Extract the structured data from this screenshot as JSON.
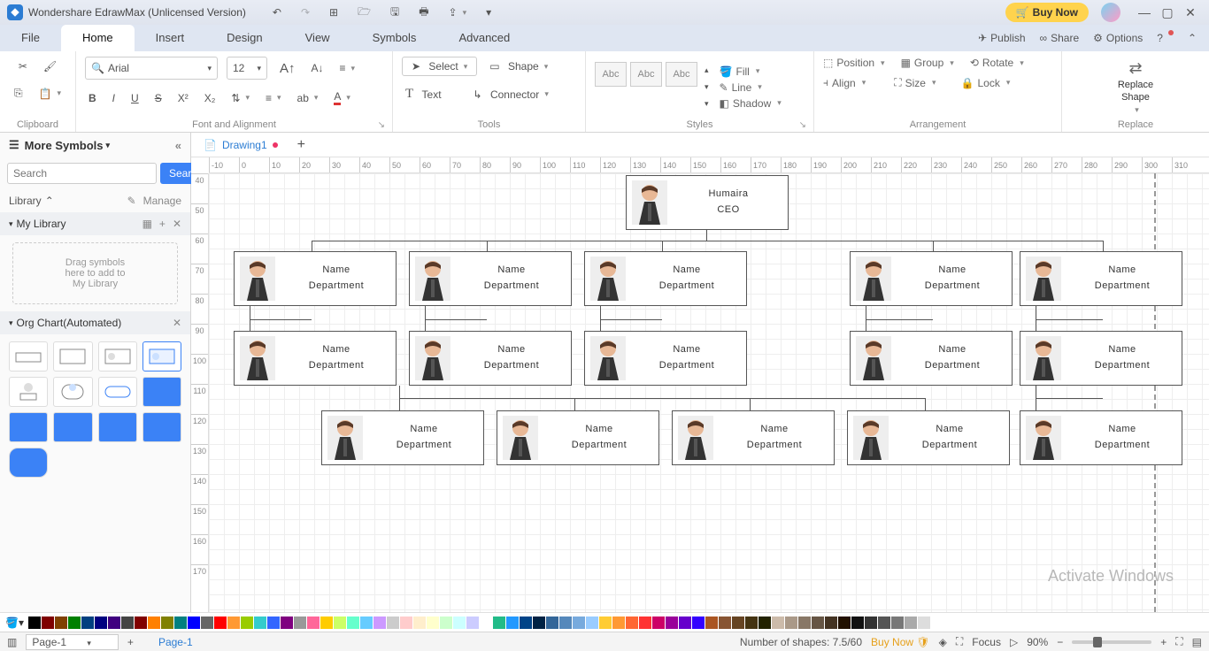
{
  "titlebar": {
    "title": "Wondershare EdrawMax (Unlicensed Version)",
    "buy": "Buy Now"
  },
  "menu": {
    "file": "File",
    "home": "Home",
    "insert": "Insert",
    "design": "Design",
    "view": "View",
    "symbols": "Symbols",
    "advanced": "Advanced",
    "publish": "Publish",
    "share": "Share",
    "options": "Options"
  },
  "ribbon": {
    "clipboard": "Clipboard",
    "font_alignment": "Font and Alignment",
    "tools": "Tools",
    "styles": "Styles",
    "arrangement": "Arrangement",
    "replace": "Replace",
    "font_name": "Arial",
    "font_size": "12",
    "select": "Select",
    "shape": "Shape",
    "text": "Text",
    "connector": "Connector",
    "style_abc": "Abc",
    "fill": "Fill",
    "line": "Line",
    "shadow": "Shadow",
    "position": "Position",
    "group": "Group",
    "rotate": "Rotate",
    "align": "Align",
    "size": "Size",
    "lock": "Lock",
    "replace_shape": "Replace\nShape"
  },
  "left": {
    "more_symbols": "More Symbols",
    "search_ph": "Search",
    "search_btn": "Search",
    "library": "Library",
    "manage": "Manage",
    "my_library": "My Library",
    "drop1": "Drag symbols",
    "drop2": "here to add to",
    "drop3": "My Library",
    "org_chart": "Org Chart(Automated)"
  },
  "doc": {
    "drawing": "Drawing1"
  },
  "org": {
    "ceo_name": "Humaira",
    "ceo_title": "CEO",
    "name": "Name",
    "dept": "Department"
  },
  "ruler_h": [
    "-10",
    "0",
    "10",
    "20",
    "30",
    "40",
    "50",
    "60",
    "70",
    "80",
    "90",
    "100",
    "110",
    "120",
    "130",
    "140",
    "150",
    "160",
    "170",
    "180",
    "190",
    "200",
    "210",
    "220",
    "230",
    "240",
    "250",
    "260",
    "270",
    "280",
    "290",
    "300",
    "310"
  ],
  "ruler_v": [
    "40",
    "50",
    "60",
    "70",
    "80",
    "90",
    "100",
    "110",
    "120",
    "130",
    "140",
    "150",
    "160",
    "170"
  ],
  "watermark": "Activate Windows",
  "status": {
    "page": "Page-1",
    "page_tab": "Page-1",
    "shapes": "Number of shapes: 7.5/60",
    "buy": "Buy Now",
    "focus": "Focus",
    "zoom": "90%"
  },
  "colors": [
    "#000",
    "#7f0000",
    "#804000",
    "#008000",
    "#004080",
    "#000080",
    "#400080",
    "#444",
    "#800000",
    "#ff8000",
    "#808000",
    "#008080",
    "#0000ff",
    "#666",
    "#ff0000",
    "#ff9933",
    "#99cc00",
    "#33cccc",
    "#3366ff",
    "#800080",
    "#999",
    "#ff6699",
    "#ffcc00",
    "#ccff66",
    "#66ffcc",
    "#66ccff",
    "#cc99ff",
    "#ccc",
    "#ffcccc",
    "#ffeecc",
    "#ffffcc",
    "#ccffcc",
    "#ccffff",
    "#ccccff",
    "#fff",
    "#2b8",
    "#29f",
    "#048",
    "#024",
    "#369",
    "#58b",
    "#7ad",
    "#9cf",
    "#fc3",
    "#f93",
    "#f63",
    "#f33",
    "#c06",
    "#909",
    "#60c",
    "#30f",
    "#a52",
    "#853",
    "#642",
    "#431",
    "#220",
    "#cba",
    "#a98",
    "#876",
    "#654",
    "#432",
    "#210",
    "#111",
    "#333",
    "#555",
    "#777",
    "#aaa",
    "#ddd"
  ]
}
